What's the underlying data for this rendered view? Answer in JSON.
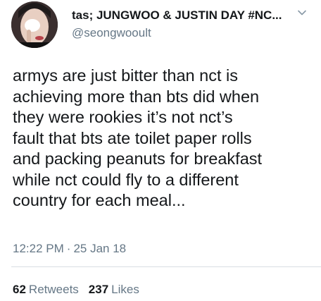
{
  "tweet": {
    "display_name": "tas; JUNGWOO & JUSTIN DAY #NC...",
    "handle": "@seongwooult",
    "text_lines": [
      "armys are just bitter than nct is",
      "achieving more than bts did when",
      "they were rookies it’s not nct’s",
      "fault that bts ate toilet paper rolls",
      "and packing peanuts for breakfast",
      "while nct could fly to a different",
      "country for each meal..."
    ],
    "time": "12:22 PM",
    "date_separator": "·",
    "date": "25 Jan 18",
    "retweets_count": "62",
    "retweets_label": "Retweets",
    "likes_count": "237",
    "likes_label": "Likes"
  },
  "icons": {
    "avatar": "profile-photo",
    "menu": "chevron-down-icon"
  },
  "colors": {
    "text_primary": "#14171a",
    "text_secondary": "#657786",
    "divider": "#d8dee2"
  }
}
